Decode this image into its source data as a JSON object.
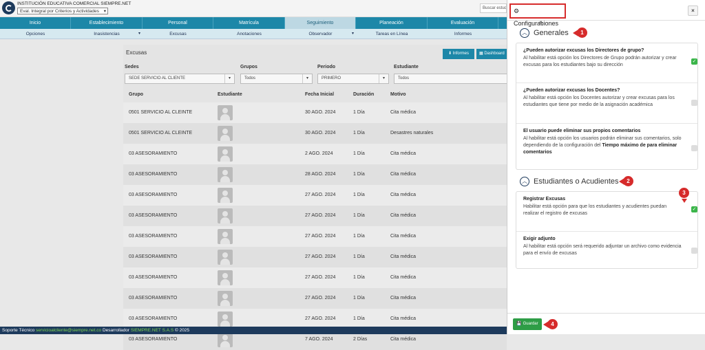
{
  "header": {
    "institution": "INSTITUCIÓN EDUCATIVA COMERCIAL SIEMPRE.NET",
    "period_select": "Eval. Integral por Criterios y Actividades",
    "search_placeholder": "Buscar estudi"
  },
  "nav_main": [
    "Inicio",
    "Establecimiento",
    "Personal",
    "Matrícula",
    "Seguimiento",
    "Planeación",
    "Evaluación"
  ],
  "nav_sub": [
    "Opciones",
    "Inasistencias",
    "Excusas",
    "Anotaciones",
    "Observador",
    "Tareas en Línea",
    "Informes"
  ],
  "main": {
    "title": "Excusas",
    "informes_btn": "Informes",
    "dashboard_btn": "Dashboard",
    "filters": {
      "sedes_label": "Sedes",
      "sedes_value": "SEDE SERVICIO AL CLIENTE",
      "grupos_label": "Grupos",
      "grupos_value": "Todos",
      "periodo_label": "Periodo",
      "periodo_value": "PRIMERO",
      "estudiante_label": "Estudiante",
      "estudiante_value": "Todos"
    },
    "columns": [
      "Grupo",
      "Estudiante",
      "Fecha Inicial",
      "Duración",
      "Motivo"
    ],
    "rows": [
      {
        "grupo": "0501 SERVICIO AL CLEINTE",
        "fecha": "30 AGO. 2024",
        "duracion": "1 Día",
        "motivo": "Cita médica"
      },
      {
        "grupo": "0501 SERVICIO AL CLEINTE",
        "fecha": "30 AGO. 2024",
        "duracion": "1 Día",
        "motivo": "Desastres naturales"
      },
      {
        "grupo": "03 ASESORAMIENTO",
        "fecha": "2 AGO. 2024",
        "duracion": "1 Día",
        "motivo": "Cita médica"
      },
      {
        "grupo": "03 ASESORAMIENTO",
        "fecha": "28 AGO. 2024",
        "duracion": "1 Día",
        "motivo": "Cita médica"
      },
      {
        "grupo": "03 ASESORAMIENTO",
        "fecha": "27 AGO. 2024",
        "duracion": "1 Día",
        "motivo": "Cita médica"
      },
      {
        "grupo": "03 ASESORAMIENTO",
        "fecha": "27 AGO. 2024",
        "duracion": "1 Día",
        "motivo": "Cita médica"
      },
      {
        "grupo": "03 ASESORAMIENTO",
        "fecha": "27 AGO. 2024",
        "duracion": "1 Día",
        "motivo": "Cita médica"
      },
      {
        "grupo": "03 ASESORAMIENTO",
        "fecha": "27 AGO. 2024",
        "duracion": "1 Día",
        "motivo": "Cita médica"
      },
      {
        "grupo": "03 ASESORAMIENTO",
        "fecha": "27 AGO. 2024",
        "duracion": "1 Día",
        "motivo": "Cita médica"
      },
      {
        "grupo": "03 ASESORAMIENTO",
        "fecha": "27 AGO. 2024",
        "duracion": "1 Día",
        "motivo": "Cita médica"
      },
      {
        "grupo": "03 ASESORAMIENTO",
        "fecha": "27 AGO. 2024",
        "duracion": "1 Día",
        "motivo": "Cita médica"
      },
      {
        "grupo": "03 ASESORAMIENTO",
        "fecha": "7 AGO. 2024",
        "duracion": "2 Días",
        "motivo": "Cita médica"
      }
    ]
  },
  "footer": {
    "support": "Soporte Técnico",
    "email": "servicioalcliente@siempre.net.co",
    "dev": "Desarrollador",
    "company": "SIEMPRE.NET S.A.S",
    "year": "© 2025"
  },
  "panel": {
    "title": "Configuraciones",
    "close": "×",
    "section1": "Generales",
    "section2": "Estudiantes o Acudientes",
    "badges": [
      "1",
      "2",
      "3",
      "4"
    ],
    "opt1_title": "¿Pueden autorizar excusas los Directores de grupo?",
    "opt1_desc": "Al habilitar está opción los Directores de Grupo podrán autorizar y crear excusas para los estudiantes bajo su dirección",
    "opt2_title": "¿Pueden autorizar excusas los Docentes?",
    "opt2_desc": "Al habilitar está opción los Docentes autorizar y crear excusas para los estudiantes que tiene por medio de la asignación académica",
    "opt3_title": "El usuario puede eliminar sus propios comentarios",
    "opt3_desc": "Al habilitar está opción los usuarios podrán eliminar sus comentarios, solo dependiendo de la configuración del",
    "opt3_bold": "Tiempo máximo de para eliminar comentarios",
    "opt4_title": "Registrar Excusas",
    "opt4_desc": "Habilitar está opción para que los estudiantes y acudientes puedan realizar el registro de excusas",
    "opt5_title": "Exigir adjunto",
    "opt5_desc": "Al habilitar está opción será requerido adjuntar un archivo como evidencia para el envío de excusas",
    "save": "Guardar",
    "checked": [
      true,
      false,
      false,
      true,
      false
    ]
  }
}
